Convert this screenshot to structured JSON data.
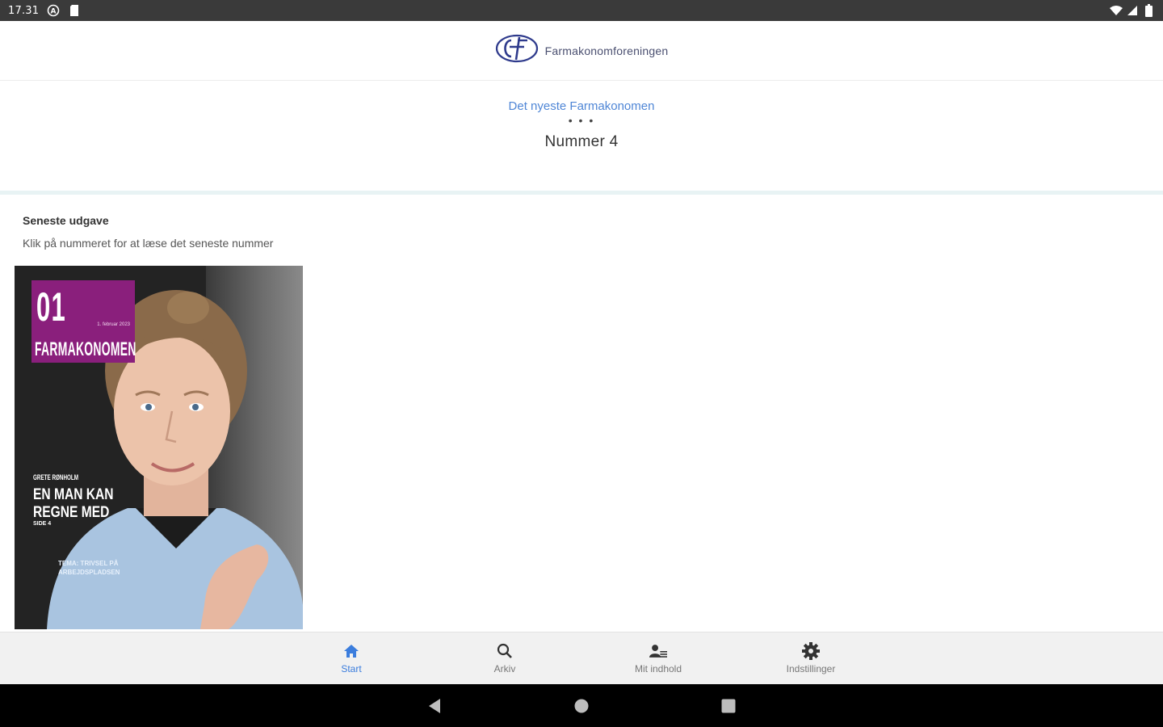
{
  "status_bar": {
    "time": "17.31",
    "icons_left": [
      "dnd-icon",
      "sd-card-icon"
    ],
    "icons_right": [
      "wifi-icon",
      "signal-icon",
      "battery-icon"
    ]
  },
  "header": {
    "logo_icon": "farmakonom-logo-icon",
    "brand_name": "Farmakonomforeningen"
  },
  "headline": {
    "link_text": "Det nyeste Farmakonomen",
    "separator": "• • •",
    "issue_title": "Nummer 4"
  },
  "latest": {
    "heading": "Seneste udgave",
    "subtitle": "Klik på nummeret for at læse det seneste nummer",
    "cover": {
      "number": "01",
      "magazine_name": "FARMAKONOMEN",
      "date_line": "1. februar 2023",
      "kicker": "GRETE RØNHOLM",
      "headline": "EN MAN KAN REGNE MED",
      "page_ref": "SIDE 4",
      "theme": "TEMA: TRIVSEL PÅ ARBEJDSPLADSEN",
      "colors": {
        "flag": "#8a1f7c",
        "background": "#232323"
      }
    }
  },
  "bottom_nav": {
    "items": [
      {
        "label": "Start",
        "icon": "home-icon",
        "active": true
      },
      {
        "label": "Arkiv",
        "icon": "search-icon",
        "active": false
      },
      {
        "label": "Mit indhold",
        "icon": "person-list-icon",
        "active": false
      },
      {
        "label": "Indstillinger",
        "icon": "gear-icon",
        "active": false
      }
    ],
    "active_color": "#3b7ddd"
  },
  "system_nav": {
    "buttons": [
      "back-icon",
      "home-circle-icon",
      "recents-icon"
    ]
  }
}
